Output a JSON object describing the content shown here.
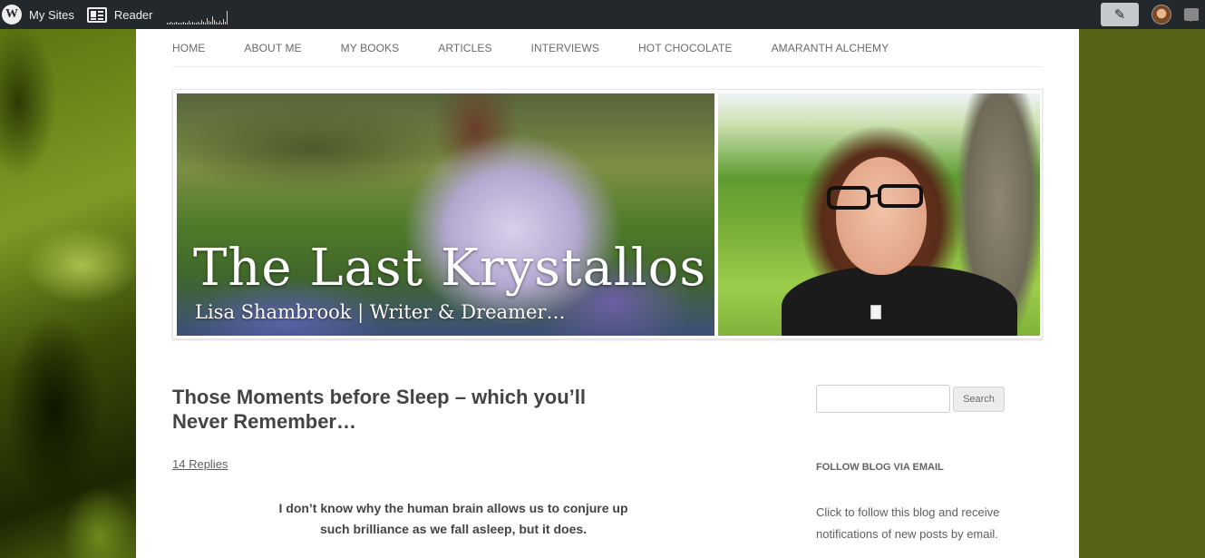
{
  "adminbar": {
    "my_sites_label": "My Sites",
    "reader_label": "Reader",
    "stats_bars": [
      1,
      1,
      2,
      1,
      1,
      2,
      1,
      1,
      1,
      2,
      1,
      1,
      3,
      1,
      2,
      1,
      1,
      2,
      1,
      4,
      2,
      1,
      6,
      3,
      2,
      8,
      4,
      2,
      1,
      3,
      1,
      5,
      2,
      14
    ]
  },
  "nav": {
    "items": [
      "HOME",
      "ABOUT ME",
      "MY BOOKS",
      "ARTICLES",
      "INTERVIEWS",
      "HOT CHOCOLATE",
      "AMARANTH ALCHEMY"
    ]
  },
  "header": {
    "site_title": "The Last Krystallos",
    "tagline": "Lisa Shambrook | Writer & Dreamer…"
  },
  "post": {
    "title": "Those Moments before Sleep – which you’ll Never Remember…",
    "replies": "14 Replies",
    "intro": "I don’t know why the human brain allows us to conjure up such brilliance as we fall asleep, but it does."
  },
  "sidebar": {
    "search_button": "Search",
    "search_value": "",
    "follow_title": "FOLLOW BLOG VIA EMAIL",
    "follow_text": "Click to follow this blog and receive notifications of new posts by email."
  }
}
